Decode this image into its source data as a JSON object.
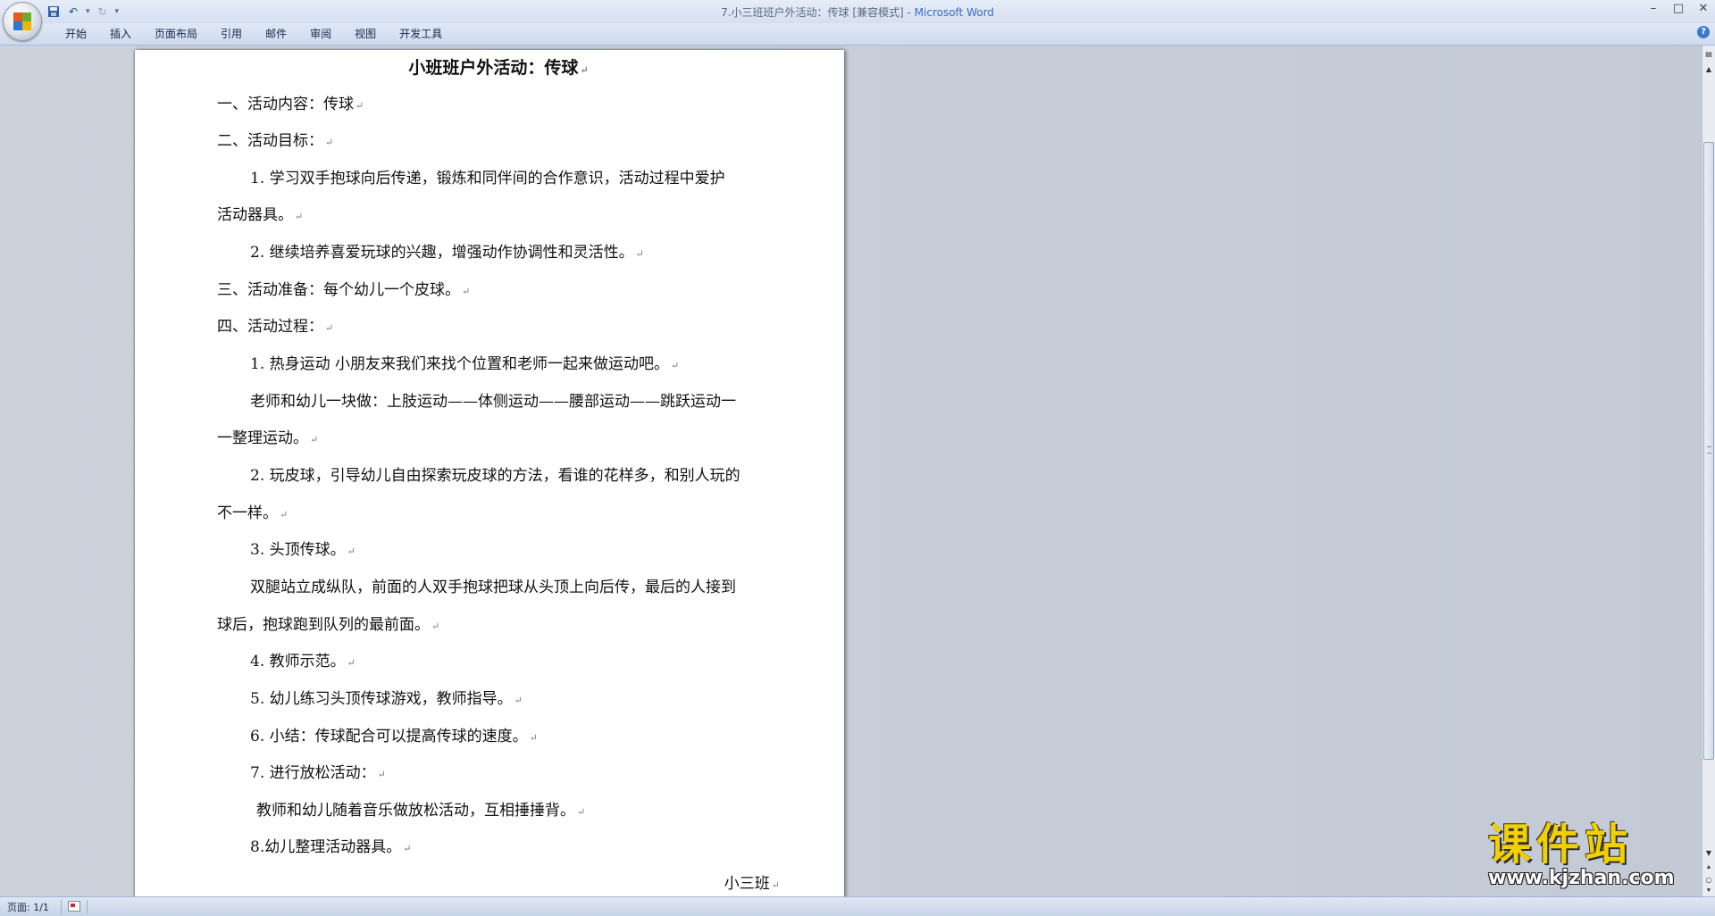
{
  "window": {
    "title": "7.小三班班户外活动：传球 [兼容模式] - ",
    "app_name": "Microsoft Word"
  },
  "quick_access": {
    "save_icon": "save-icon",
    "undo_icon": "undo-icon",
    "redo_icon": "redo-icon",
    "customize_icon": "dropdown-icon"
  },
  "ribbon": {
    "tabs": [
      "开始",
      "插入",
      "页面布局",
      "引用",
      "邮件",
      "审阅",
      "视图",
      "开发工具"
    ]
  },
  "document": {
    "title": "小班班户外活动：传球",
    "lines": [
      "一、活动内容：传球",
      "二、活动目标：",
      "1. 学习双手抱球向后传递，锻炼和同伴间的合作意识，活动过程中爱护",
      "活动器具。",
      "2. 继续培养喜爱玩球的兴趣，增强动作协调性和灵活性。",
      "三、活动准备：每个幼儿一个皮球。",
      "四、活动过程：",
      "1. 热身运动 小朋友来我们来找个位置和老师一起来做运动吧。",
      "老师和幼儿一块做：上肢运动——体侧运动——腰部运动——跳跃运动一",
      "一整理运动。",
      "2. 玩皮球，引导幼儿自由探索玩皮球的方法，看谁的花样多，和别人玩的",
      "不一样。",
      "3. 头顶传球。",
      "双腿站立成纵队，前面的人双手抱球把球从头顶上向后传，最后的人接到",
      "球后，抱球跑到队列的最前面。",
      "4. 教师示范。",
      "5. 幼儿练习头顶传球游戏，教师指导。",
      "6. 小结：传球配合可以提高传球的速度。",
      "7. 进行放松活动：",
      "教师和幼儿随着音乐做放松活动，互相捶捶背。",
      "8.幼儿整理活动器具。",
      "小三班"
    ],
    "paragraph_mark": "↵"
  },
  "status": {
    "page_label": "页面: 1/1"
  },
  "watermark": {
    "main": "课件站",
    "url": "www.kjzhan.com"
  },
  "colors": {
    "watermark_yellow": "#f2d000",
    "app_name_blue": "#3a6fc7",
    "workspace_bg": "#c5ccd8"
  }
}
